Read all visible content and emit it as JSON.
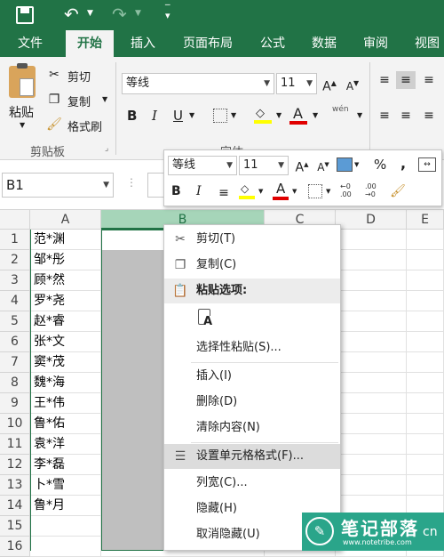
{
  "tabs": [
    "文件",
    "开始",
    "插入",
    "页面布局",
    "公式",
    "数据",
    "审阅",
    "视图"
  ],
  "ribbon": {
    "paste": "粘贴",
    "cut": "剪切",
    "copy": "复制",
    "format_painter": "格式刷",
    "clipboard_group": "剪贴板",
    "font_name": "等线",
    "font_size": "11",
    "bold": "B",
    "italic": "I",
    "underline": "U",
    "wen": "wén",
    "font_group": "字体"
  },
  "formula_bar": {
    "name_box": "B1"
  },
  "columns": [
    "A",
    "B",
    "C",
    "D",
    "E"
  ],
  "rows": [
    "1",
    "2",
    "3",
    "4",
    "5",
    "6",
    "7",
    "8",
    "9",
    "10",
    "11",
    "12",
    "13",
    "14",
    "15",
    "16"
  ],
  "cells_a": [
    "范*渊",
    "邹*彤",
    "顾*然",
    "罗*尧",
    "赵*睿",
    "张*文",
    "窦*茂",
    "魏*海",
    "王*伟",
    "鲁*佑",
    "袁*洋",
    "李*磊",
    "卜*雪",
    "鲁*月"
  ],
  "mini_toolbar": {
    "font_name": "等线",
    "font_size": "11",
    "percent": "%",
    "comma": ","
  },
  "context_menu": {
    "cut": "剪切(T)",
    "copy": "复制(C)",
    "paste_options": "粘贴选项:",
    "paste_special": "选择性粘贴(S)...",
    "insert": "插入(I)",
    "delete": "删除(D)",
    "clear": "清除内容(N)",
    "format_cells": "设置单元格格式(F)...",
    "col_width": "列宽(C)...",
    "hide": "隐藏(H)",
    "unhide": "取消隐藏(U)"
  },
  "watermark": {
    "title": "笔记部落",
    "url": "www.notetribe.com",
    "suffix": "cn"
  },
  "colors": {
    "excel_green": "#217346",
    "selection": "#bfbfbf",
    "selected_header": "#a6d5b9"
  }
}
